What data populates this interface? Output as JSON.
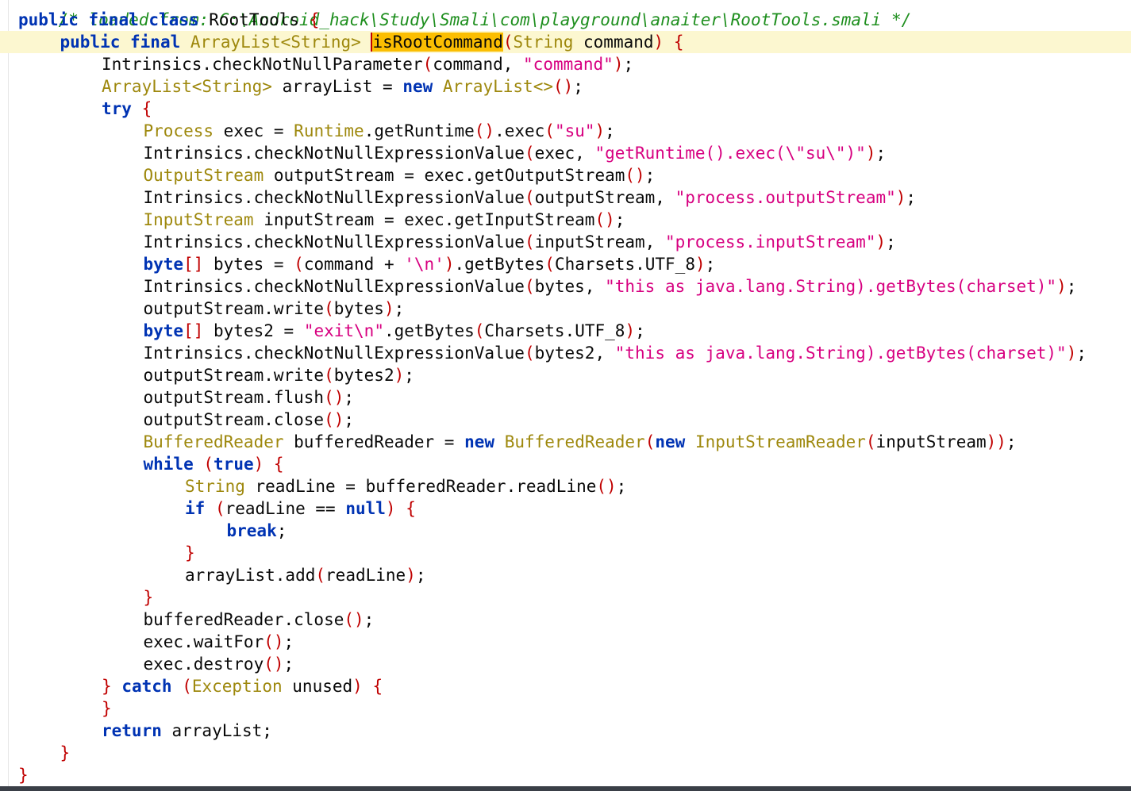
{
  "editor": {
    "file_header": "/* loaded from: C:\\Android_hack\\Study\\Smali\\com\\playground\\anaiter\\RootTools.smali */",
    "highlight_color": "#fbbe02",
    "current_line_bg": "#fcf7d0",
    "lines": [
      {
        "indent": 0,
        "tokens": [
          {
            "t": "public",
            "c": "kw"
          },
          {
            "t": " "
          },
          {
            "t": "final",
            "c": "kw"
          },
          {
            "t": " "
          },
          {
            "t": "class",
            "c": "kw"
          },
          {
            "t": " RootTools "
          },
          {
            "t": "{",
            "c": "brace"
          }
        ]
      },
      {
        "indent": 1,
        "current": true,
        "tokens": [
          {
            "t": "public",
            "c": "kw"
          },
          {
            "t": " "
          },
          {
            "t": "final",
            "c": "kw"
          },
          {
            "t": " "
          },
          {
            "t": "ArrayList<String>",
            "c": "type"
          },
          {
            "t": " "
          },
          {
            "t": "isRootCommand",
            "c": "sel"
          },
          {
            "t": "(",
            "c": "brace"
          },
          {
            "t": "String",
            "c": "type"
          },
          {
            "t": " command"
          },
          {
            "t": ")",
            "c": "brace"
          },
          {
            "t": " "
          },
          {
            "t": "{",
            "c": "brace"
          }
        ]
      },
      {
        "indent": 2,
        "tokens": [
          {
            "t": "Intrinsics.checkNotNullParameter"
          },
          {
            "t": "(",
            "c": "brace"
          },
          {
            "t": "command, "
          },
          {
            "t": "\"command\"",
            "c": "str"
          },
          {
            "t": ")",
            "c": "brace"
          },
          {
            "t": ";"
          }
        ]
      },
      {
        "indent": 2,
        "tokens": [
          {
            "t": "ArrayList<String>",
            "c": "type"
          },
          {
            "t": " arrayList = "
          },
          {
            "t": "new",
            "c": "kw"
          },
          {
            "t": " "
          },
          {
            "t": "ArrayList<>",
            "c": "type"
          },
          {
            "t": "()",
            "c": "brace"
          },
          {
            "t": ";"
          }
        ]
      },
      {
        "indent": 2,
        "tokens": [
          {
            "t": "try",
            "c": "kw"
          },
          {
            "t": " "
          },
          {
            "t": "{",
            "c": "brace"
          }
        ]
      },
      {
        "indent": 3,
        "tokens": [
          {
            "t": "Process",
            "c": "type"
          },
          {
            "t": " exec = "
          },
          {
            "t": "Runtime",
            "c": "type"
          },
          {
            "t": ".getRuntime"
          },
          {
            "t": "()",
            "c": "brace"
          },
          {
            "t": ".exec"
          },
          {
            "t": "(",
            "c": "brace"
          },
          {
            "t": "\"su\"",
            "c": "str"
          },
          {
            "t": ")",
            "c": "brace"
          },
          {
            "t": ";"
          }
        ]
      },
      {
        "indent": 3,
        "tokens": [
          {
            "t": "Intrinsics.checkNotNullExpressionValue"
          },
          {
            "t": "(",
            "c": "brace"
          },
          {
            "t": "exec, "
          },
          {
            "t": "\"getRuntime().exec(\\\"su\\\")\"",
            "c": "str"
          },
          {
            "t": ")",
            "c": "brace"
          },
          {
            "t": ";"
          }
        ]
      },
      {
        "indent": 3,
        "tokens": [
          {
            "t": "OutputStream",
            "c": "type"
          },
          {
            "t": " outputStream = exec.getOutputStream"
          },
          {
            "t": "()",
            "c": "brace"
          },
          {
            "t": ";"
          }
        ]
      },
      {
        "indent": 3,
        "tokens": [
          {
            "t": "Intrinsics.checkNotNullExpressionValue"
          },
          {
            "t": "(",
            "c": "brace"
          },
          {
            "t": "outputStream, "
          },
          {
            "t": "\"process.outputStream\"",
            "c": "str"
          },
          {
            "t": ")",
            "c": "brace"
          },
          {
            "t": ";"
          }
        ]
      },
      {
        "indent": 3,
        "tokens": [
          {
            "t": "InputStream",
            "c": "type"
          },
          {
            "t": " inputStream = exec.getInputStream"
          },
          {
            "t": "()",
            "c": "brace"
          },
          {
            "t": ";"
          }
        ]
      },
      {
        "indent": 3,
        "tokens": [
          {
            "t": "Intrinsics.checkNotNullExpressionValue"
          },
          {
            "t": "(",
            "c": "brace"
          },
          {
            "t": "inputStream, "
          },
          {
            "t": "\"process.inputStream\"",
            "c": "str"
          },
          {
            "t": ")",
            "c": "brace"
          },
          {
            "t": ";"
          }
        ]
      },
      {
        "indent": 3,
        "tokens": [
          {
            "t": "byte",
            "c": "kw"
          },
          {
            "t": "[]",
            "c": "brace"
          },
          {
            "t": " bytes = "
          },
          {
            "t": "(",
            "c": "brace"
          },
          {
            "t": "command + "
          },
          {
            "t": "'\\n'",
            "c": "str"
          },
          {
            "t": ")",
            "c": "brace"
          },
          {
            "t": ".getBytes"
          },
          {
            "t": "(",
            "c": "brace"
          },
          {
            "t": "Charsets.UTF_8"
          },
          {
            "t": ")",
            "c": "brace"
          },
          {
            "t": ";"
          }
        ]
      },
      {
        "indent": 3,
        "tokens": [
          {
            "t": "Intrinsics.checkNotNullExpressionValue"
          },
          {
            "t": "(",
            "c": "brace"
          },
          {
            "t": "bytes, "
          },
          {
            "t": "\"this as java.lang.String).getBytes(charset)\"",
            "c": "str"
          },
          {
            "t": ")",
            "c": "brace"
          },
          {
            "t": ";"
          }
        ]
      },
      {
        "indent": 3,
        "tokens": [
          {
            "t": "outputStream.write"
          },
          {
            "t": "(",
            "c": "brace"
          },
          {
            "t": "bytes"
          },
          {
            "t": ")",
            "c": "brace"
          },
          {
            "t": ";"
          }
        ]
      },
      {
        "indent": 3,
        "tokens": [
          {
            "t": "byte",
            "c": "kw"
          },
          {
            "t": "[]",
            "c": "brace"
          },
          {
            "t": " bytes2 = "
          },
          {
            "t": "\"exit\\n\"",
            "c": "str"
          },
          {
            "t": ".getBytes"
          },
          {
            "t": "(",
            "c": "brace"
          },
          {
            "t": "Charsets.UTF_8"
          },
          {
            "t": ")",
            "c": "brace"
          },
          {
            "t": ";"
          }
        ]
      },
      {
        "indent": 3,
        "tokens": [
          {
            "t": "Intrinsics.checkNotNullExpressionValue"
          },
          {
            "t": "(",
            "c": "brace"
          },
          {
            "t": "bytes2, "
          },
          {
            "t": "\"this as java.lang.String).getBytes(charset)\"",
            "c": "str"
          },
          {
            "t": ")",
            "c": "brace"
          },
          {
            "t": ";"
          }
        ]
      },
      {
        "indent": 3,
        "tokens": [
          {
            "t": "outputStream.write"
          },
          {
            "t": "(",
            "c": "brace"
          },
          {
            "t": "bytes2"
          },
          {
            "t": ")",
            "c": "brace"
          },
          {
            "t": ";"
          }
        ]
      },
      {
        "indent": 3,
        "tokens": [
          {
            "t": "outputStream.flush"
          },
          {
            "t": "()",
            "c": "brace"
          },
          {
            "t": ";"
          }
        ]
      },
      {
        "indent": 3,
        "tokens": [
          {
            "t": "outputStream.close"
          },
          {
            "t": "()",
            "c": "brace"
          },
          {
            "t": ";"
          }
        ]
      },
      {
        "indent": 3,
        "tokens": [
          {
            "t": "BufferedReader",
            "c": "type"
          },
          {
            "t": " bufferedReader = "
          },
          {
            "t": "new",
            "c": "kw"
          },
          {
            "t": " "
          },
          {
            "t": "BufferedReader",
            "c": "type"
          },
          {
            "t": "(",
            "c": "brace"
          },
          {
            "t": "new",
            "c": "kw"
          },
          {
            "t": " "
          },
          {
            "t": "InputStreamReader",
            "c": "type"
          },
          {
            "t": "(",
            "c": "brace"
          },
          {
            "t": "inputStream"
          },
          {
            "t": "))",
            "c": "brace"
          },
          {
            "t": ";"
          }
        ]
      },
      {
        "indent": 3,
        "tokens": [
          {
            "t": "while",
            "c": "kw"
          },
          {
            "t": " "
          },
          {
            "t": "(",
            "c": "brace"
          },
          {
            "t": "true",
            "c": "kw"
          },
          {
            "t": ")",
            "c": "brace"
          },
          {
            "t": " "
          },
          {
            "t": "{",
            "c": "brace"
          }
        ]
      },
      {
        "indent": 4,
        "tokens": [
          {
            "t": "String",
            "c": "type"
          },
          {
            "t": " readLine = bufferedReader.readLine"
          },
          {
            "t": "()",
            "c": "brace"
          },
          {
            "t": ";"
          }
        ]
      },
      {
        "indent": 4,
        "tokens": [
          {
            "t": "if",
            "c": "kw"
          },
          {
            "t": " "
          },
          {
            "t": "(",
            "c": "brace"
          },
          {
            "t": "readLine == "
          },
          {
            "t": "null",
            "c": "kw"
          },
          {
            "t": ")",
            "c": "brace"
          },
          {
            "t": " "
          },
          {
            "t": "{",
            "c": "brace"
          }
        ]
      },
      {
        "indent": 5,
        "tokens": [
          {
            "t": "break",
            "c": "kw"
          },
          {
            "t": ";"
          }
        ]
      },
      {
        "indent": 4,
        "tokens": [
          {
            "t": "}",
            "c": "brace"
          }
        ]
      },
      {
        "indent": 4,
        "tokens": [
          {
            "t": "arrayList.add"
          },
          {
            "t": "(",
            "c": "brace"
          },
          {
            "t": "readLine"
          },
          {
            "t": ")",
            "c": "brace"
          },
          {
            "t": ";"
          }
        ]
      },
      {
        "indent": 3,
        "tokens": [
          {
            "t": "}",
            "c": "brace"
          }
        ]
      },
      {
        "indent": 3,
        "tokens": [
          {
            "t": "bufferedReader.close"
          },
          {
            "t": "()",
            "c": "brace"
          },
          {
            "t": ";"
          }
        ]
      },
      {
        "indent": 3,
        "tokens": [
          {
            "t": "exec.waitFor"
          },
          {
            "t": "()",
            "c": "brace"
          },
          {
            "t": ";"
          }
        ]
      },
      {
        "indent": 3,
        "tokens": [
          {
            "t": "exec.destroy"
          },
          {
            "t": "()",
            "c": "brace"
          },
          {
            "t": ";"
          }
        ]
      },
      {
        "indent": 2,
        "tokens": [
          {
            "t": "}",
            "c": "brace"
          },
          {
            "t": " "
          },
          {
            "t": "catch",
            "c": "kw"
          },
          {
            "t": " "
          },
          {
            "t": "(",
            "c": "brace"
          },
          {
            "t": "Exception",
            "c": "type"
          },
          {
            "t": " unused"
          },
          {
            "t": ")",
            "c": "brace"
          },
          {
            "t": " "
          },
          {
            "t": "{",
            "c": "brace"
          }
        ]
      },
      {
        "indent": 2,
        "tokens": [
          {
            "t": "}",
            "c": "brace"
          }
        ]
      },
      {
        "indent": 2,
        "tokens": [
          {
            "t": "return",
            "c": "kw"
          },
          {
            "t": " arrayList;"
          }
        ]
      },
      {
        "indent": 1,
        "tokens": [
          {
            "t": "}",
            "c": "brace"
          }
        ]
      },
      {
        "indent": 0,
        "tokens": [
          {
            "t": "}",
            "c": "brace"
          }
        ]
      }
    ]
  }
}
